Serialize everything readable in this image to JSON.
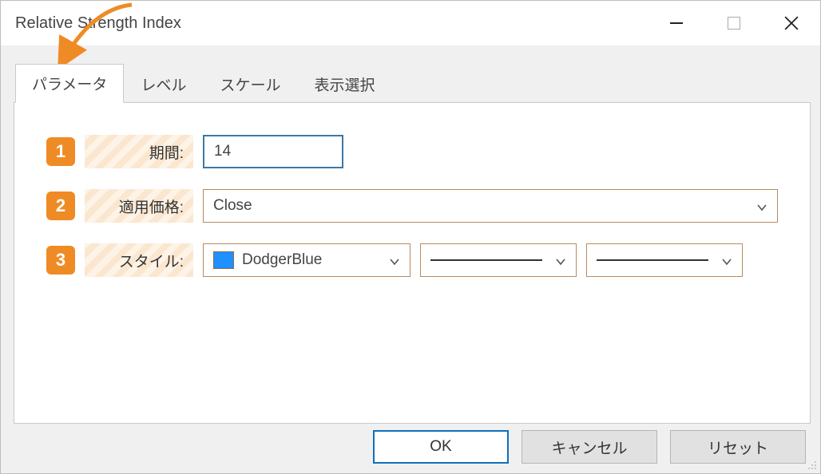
{
  "title": "Relative Strength Index",
  "tabs": [
    {
      "label": "パラメータ",
      "active": true
    },
    {
      "label": "レベル",
      "active": false
    },
    {
      "label": "スケール",
      "active": false
    },
    {
      "label": "表示選択",
      "active": false
    }
  ],
  "params": {
    "badge1": "1",
    "badge2": "2",
    "badge3": "3",
    "period_label": "期間:",
    "period_value": "14",
    "price_label": "適用価格:",
    "price_value": "Close",
    "style_label": "スタイル:",
    "color_name": "DodgerBlue",
    "color_hex": "#1e90ff"
  },
  "buttons": {
    "ok": "OK",
    "cancel": "キャンセル",
    "reset": "リセット"
  }
}
